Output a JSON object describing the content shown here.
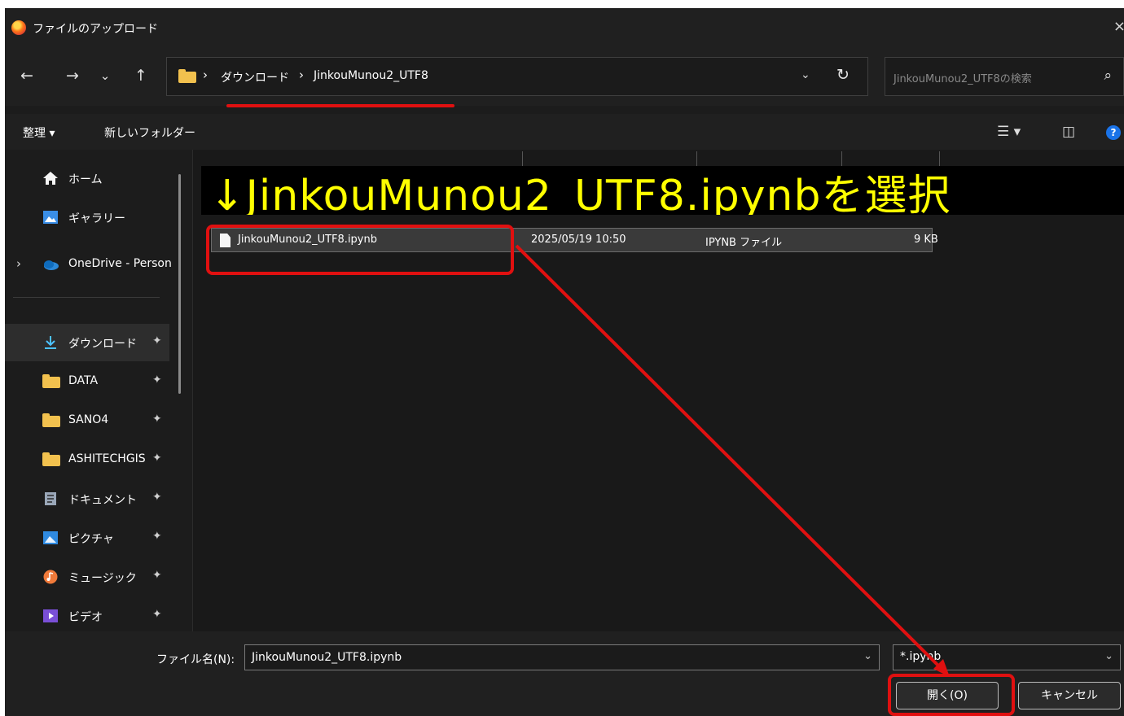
{
  "titlebar": {
    "title": "ファイルのアップロード",
    "close": "×"
  },
  "nav": {
    "back": "←",
    "forward": "→",
    "recent": "⌄",
    "up": "↑",
    "refresh": "↻"
  },
  "address": {
    "crumbs": [
      "ダウンロード",
      "JinkouMunou2_UTF8"
    ],
    "separator": "›",
    "dropdown": "⌄"
  },
  "search": {
    "placeholder": "JinkouMunou2_UTF8の検索",
    "icon": "⌕"
  },
  "commandbar": {
    "organize": "整理 ▾",
    "new_folder": "新しいフォルダー",
    "view_icon": "☰ ▾",
    "pane_icon": "◫",
    "help": "?"
  },
  "sidebar": {
    "items": [
      {
        "label": "ホーム",
        "icon": "home-icon",
        "pinned": false
      },
      {
        "label": "ギャラリー",
        "icon": "gallery-icon",
        "pinned": false
      },
      {
        "label": "OneDrive - Personal",
        "icon": "onedrive-icon",
        "pinned": false,
        "expandable": true
      },
      {
        "label": "ダウンロード",
        "icon": "download-icon",
        "pinned": true,
        "selected": true
      },
      {
        "label": "DATA",
        "icon": "folder-icon",
        "pinned": true
      },
      {
        "label": "SANO4",
        "icon": "folder-icon",
        "pinned": true
      },
      {
        "label": "ASHITECHGIS",
        "icon": "folder-icon",
        "pinned": true
      },
      {
        "label": "ドキュメント",
        "icon": "documents-icon",
        "pinned": true
      },
      {
        "label": "ピクチャ",
        "icon": "pictures-icon",
        "pinned": true
      },
      {
        "label": "ミュージック",
        "icon": "music-icon",
        "pinned": true
      },
      {
        "label": "ビデオ",
        "icon": "videos-icon",
        "pinned": true
      }
    ],
    "pin_glyph": "📌"
  },
  "files": [
    {
      "name": "JinkouMunou2_UTF8.ipynb",
      "modified": "2025/05/19 10:50",
      "type": "IPYNB ファイル",
      "size": "9 KB"
    }
  ],
  "annotation": {
    "banner_text": "↓JinkouMunou2_UTF8.ipynbを選択",
    "color": "#e01010",
    "banner_color": "#ffff00"
  },
  "bottom": {
    "filename_label": "ファイル名(N):",
    "filename_value": "JinkouMunou2_UTF8.ipynb",
    "filter_value": "*.ipynb",
    "open_button": "開く(O)",
    "cancel_button": "キャンセル",
    "dropdown": "⌄"
  }
}
